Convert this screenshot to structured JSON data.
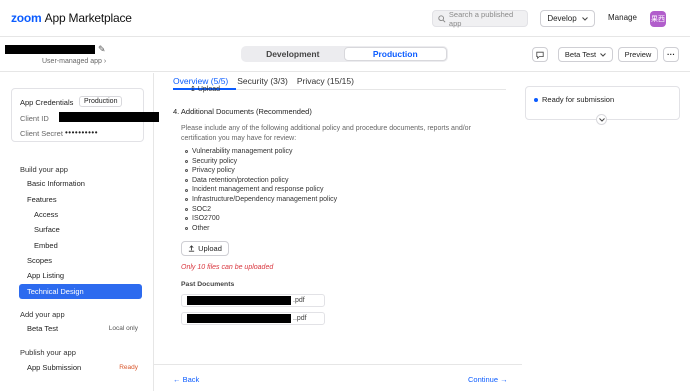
{
  "header": {
    "logo_brand": "zoom",
    "logo_text": "App Marketplace",
    "search_placeholder": "Search a published app",
    "develop_label": "Develop",
    "manage_label": "Manage",
    "avatar_initials": "果西"
  },
  "appbar": {
    "app_subtitle": "User-managed app",
    "tabs": {
      "development": "Development",
      "production": "Production"
    },
    "beta_label": "Beta Test",
    "preview_label": "Preview",
    "more_label": "···"
  },
  "sidebar": {
    "credentials": {
      "title": "App Credentials",
      "env_badge": "Production",
      "client_id_label": "Client ID",
      "client_secret_label": "Client Secret",
      "client_secret_value": "••••••••••"
    },
    "build_title": "Build your app",
    "items": [
      {
        "label": "Basic Information"
      },
      {
        "label": "Features"
      },
      {
        "label": "Access"
      },
      {
        "label": "Surface"
      },
      {
        "label": "Embed"
      },
      {
        "label": "Scopes"
      },
      {
        "label": "App Listing"
      },
      {
        "label": "Technical Design"
      }
    ],
    "add_title": "Add your app",
    "beta_item": {
      "label": "Beta Test",
      "tag": "Local only"
    },
    "publish_title": "Publish your app",
    "submission_item": {
      "label": "App Submission",
      "tag": "Ready"
    }
  },
  "main": {
    "tabs": [
      "Overview (5/5)",
      "Security (3/3)",
      "Privacy (15/15)"
    ],
    "upload_cut": "Upload",
    "section_title": "4. Additional Documents (Recommended)",
    "section_desc": "Please include any of the following additional policy and procedure documents, reports and/or certification you may have for review:",
    "documents": [
      "Vulnerability management policy",
      "Security policy",
      "Privacy policy",
      "Data retention/protection policy",
      "Incident management and response policy",
      "Infrastructure/Dependency management policy",
      "SOC2",
      "ISO2700",
      "Other"
    ],
    "upload_label": "Upload",
    "limit_text": "Only 10 files can be uploaded",
    "past_docs_label": "Past Documents",
    "past_files": [
      {
        "ext": ".pdf"
      },
      {
        "ext": "..pdf"
      }
    ],
    "back_label": "Back",
    "continue_label": "Continue"
  },
  "status": {
    "text": "Ready for submission",
    "dot_color": "#0b5cff"
  },
  "colors": {
    "accent": "#0b5cff",
    "active_nav": "#2d6bef",
    "error": "#d9363e",
    "ready_tag": "#d9562b"
  }
}
